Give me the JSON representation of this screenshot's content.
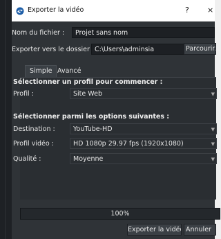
{
  "window": {
    "title": "Exporter la vidéo",
    "help_label": "?",
    "close_label": "×"
  },
  "form": {
    "filename_label": "Nom du fichier :",
    "filename_value": "Projet sans nom",
    "folder_label": "Exporter vers le dossier",
    "folder_value": "C:\\Users\\adminsia",
    "browse_label": "Parcourir..."
  },
  "tabs": [
    {
      "label": "Simple",
      "active": true
    },
    {
      "label": "Avancé",
      "active": false
    }
  ],
  "simple": {
    "profile_section_title": "Sélectionner un profil pour commencer :",
    "profile_label": "Profil :",
    "profile_value": "Site Web",
    "options_section_title": "Sélectionner parmi les options suivantes :",
    "destination_label": "Destination :",
    "destination_value": "YouTube-HD",
    "video_profile_label": "Profil vidéo :",
    "video_profile_value": "HD 1080p 29.97 fps (1920x1080)",
    "quality_label": "Qualité :",
    "quality_value": "Moyenne"
  },
  "progress": {
    "value_percent": 100,
    "label": "100%"
  },
  "footer": {
    "export_label": "Exporter la vidéo",
    "cancel_label": "Annuler"
  },
  "icons": {
    "app_icon": "openshot-logo-icon",
    "combo_arrow": "chevron-down-icon"
  },
  "colors": {
    "window_bg": "#2f3337",
    "titlebar_bg": "#ffffff",
    "field_bg": "#1d2024",
    "text": "#e6e6e6"
  }
}
